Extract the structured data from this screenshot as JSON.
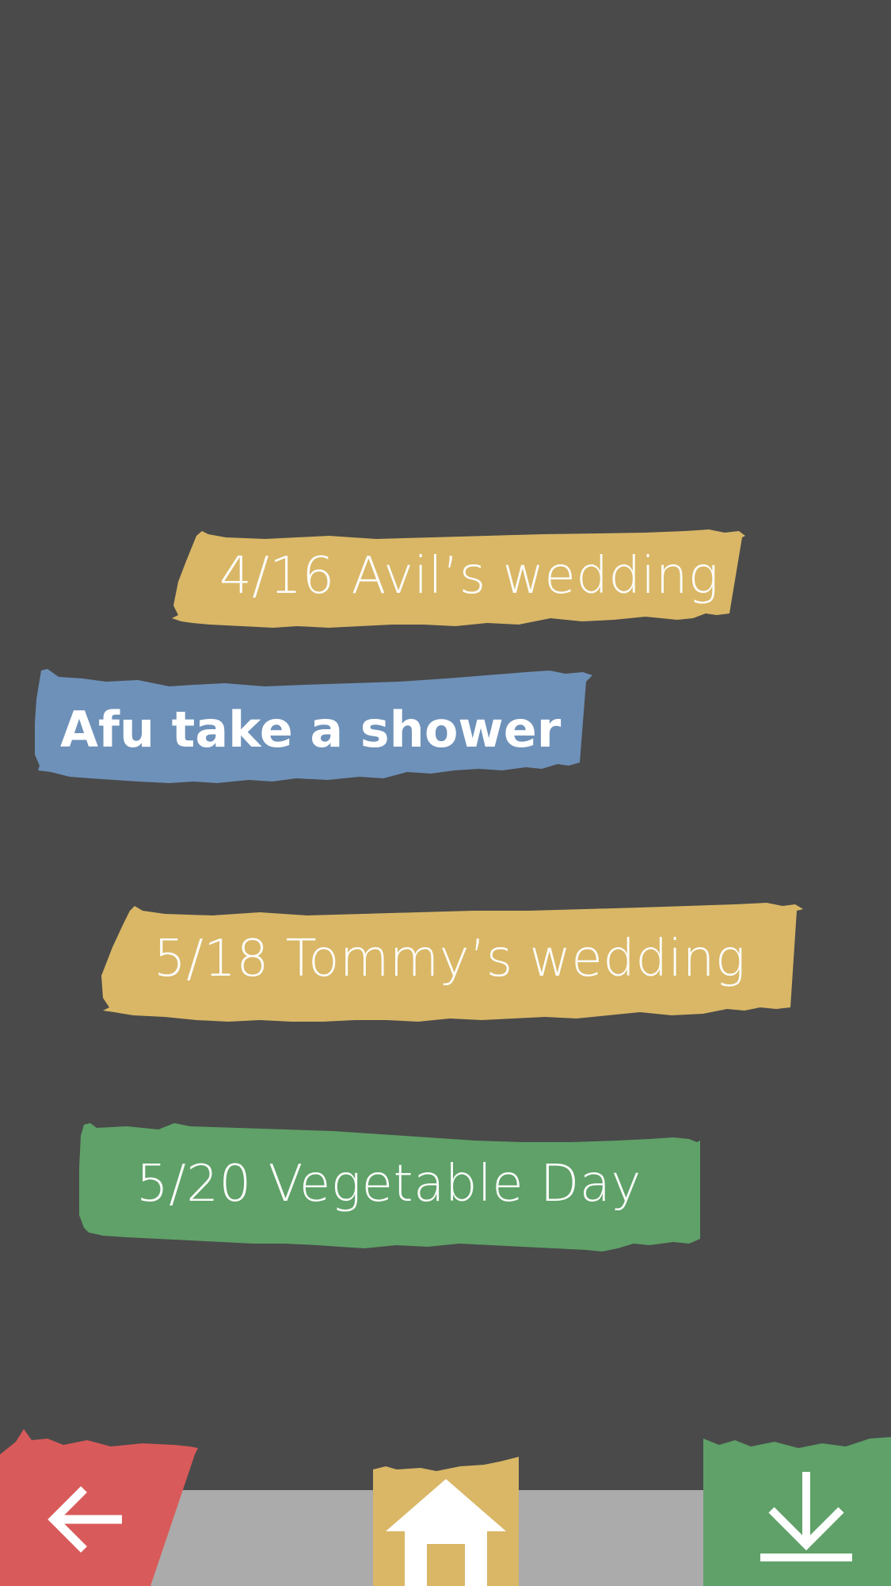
{
  "colors": {
    "background": "#4a4a4a",
    "yellow": "#d9b766",
    "blue": "#6e91b9",
    "green": "#5fa168",
    "red": "#d95a5a",
    "strip": "#ababab",
    "text": "#ffffff"
  },
  "events": [
    {
      "label": "4/16 Avil’s wedding",
      "color": "yellow",
      "style": "light"
    },
    {
      "label": "Afu take a shower",
      "color": "blue",
      "style": "bold"
    },
    {
      "label": "5/18 Tommy’s wedding",
      "color": "yellow",
      "style": "light"
    },
    {
      "label": "5/20 Vegetable Day",
      "color": "green",
      "style": "light"
    }
  ],
  "nav": {
    "back": {
      "icon": "arrow-left-icon",
      "color": "red"
    },
    "home": {
      "icon": "home-icon",
      "color": "yellow"
    },
    "download": {
      "icon": "download-icon",
      "color": "green"
    }
  }
}
